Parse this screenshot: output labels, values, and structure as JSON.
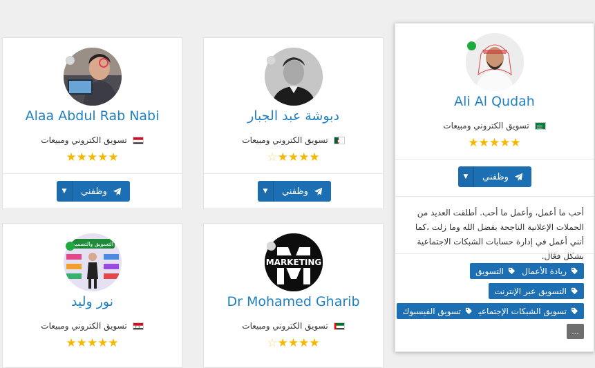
{
  "cards": [
    {
      "name": "Ali Al Qudah",
      "job": "تسويق الكتروني ومبيعات",
      "flag": "saudi-arabia",
      "status": "online",
      "rating": 5,
      "hire_label": "وظفني",
      "bio": "أحب ما أعمل، وأعمل ما أحب. أطلقت العديد من الحملات الإعلانية الناجحة بفضل الله وما زلت ،كما أنني أعمل في إدارة حسابات الشبكات الاجتماعية بشكل فعّال.",
      "tags": [
        "ريادة الأعمال",
        "التسويق",
        "التسويق عبر الإنترنت",
        "تسويق الشبكات الإجتماعية",
        "تسويق الفيسبوك"
      ],
      "more_label": "..."
    },
    {
      "name": "دبوشة عبد الجبار",
      "job": "تسويق الكتروني ومبيعات",
      "flag": "algeria",
      "status": "offline",
      "rating": 4.5,
      "hire_label": "وظفني"
    },
    {
      "name": "Alaa Abdul Rab Nabi",
      "job": "تسويق الكتروني ومبيعات",
      "flag": "yemen",
      "status": "offline",
      "rating": 5,
      "hire_label": "وظفني"
    },
    {
      "name": "Dr Mohamed Gharib",
      "job": "تسويق الكتروني ومبيعات",
      "flag": "uae",
      "status": "offline",
      "rating": 4.5,
      "avatar_text": "MARKETING"
    },
    {
      "name": "نور وليد",
      "job": "تسويق الكتروني ومبيعات",
      "flag": "syria",
      "status": "online",
      "rating": 5,
      "avatar_text": "التسويق والتصميم"
    }
  ],
  "icons": {
    "send": "paper-plane-icon",
    "caret": "caret-down-icon",
    "tag": "tag-icon",
    "star": "star-icon"
  },
  "colors": {
    "accent": "#1d6fb3",
    "name": "#1f7fc0",
    "star": "#f5b800",
    "online": "#1eaa3c"
  }
}
